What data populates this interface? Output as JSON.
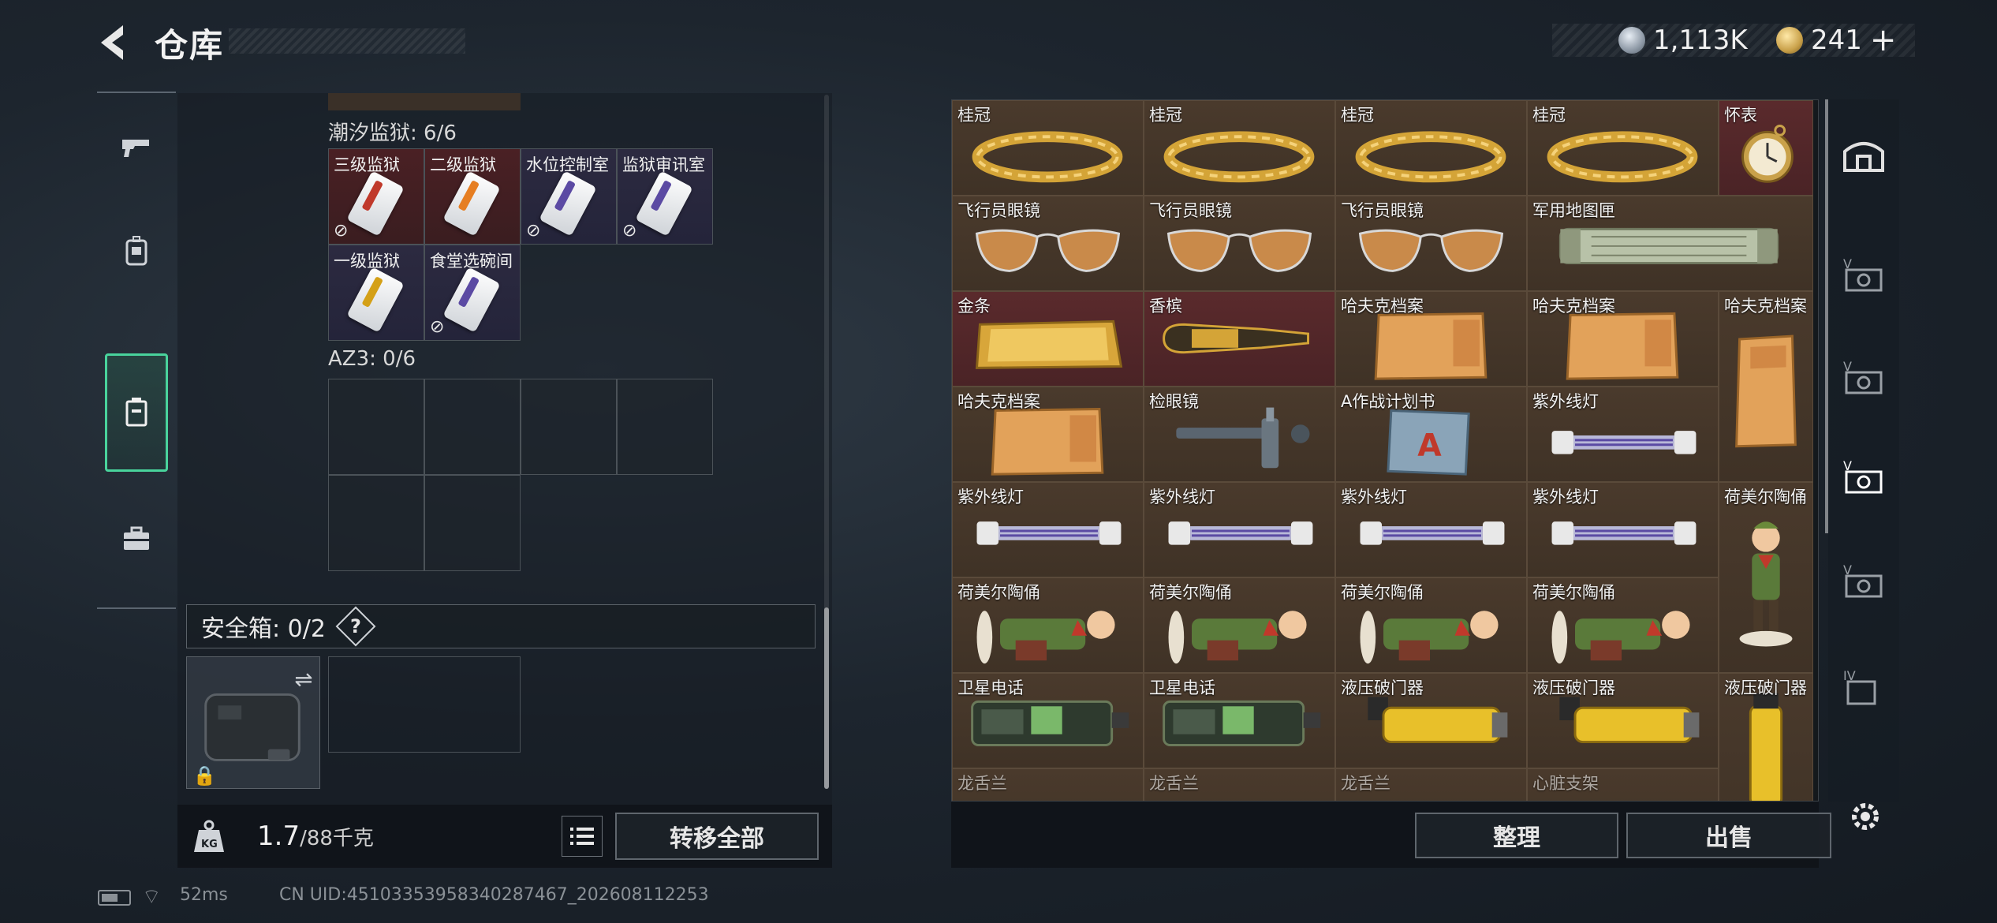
{
  "header": {
    "title": "仓库",
    "currency_coin": "1,113K",
    "currency_gold": "241",
    "currency_plus": "+"
  },
  "left_nav": {
    "items": [
      "weapons",
      "gear",
      "storage",
      "keys"
    ]
  },
  "key_section": {
    "group1_label": "潮汐监狱: 6/6",
    "keys": [
      {
        "name": "三级监狱",
        "has_badge": true
      },
      {
        "name": "二级监狱",
        "has_badge": false
      },
      {
        "name": "水位控制室",
        "has_badge": true
      },
      {
        "name": "监狱审讯室",
        "has_badge": true
      },
      {
        "name": "一级监狱",
        "has_badge": false
      },
      {
        "name": "食堂选碗间",
        "has_badge": true
      }
    ],
    "group2_label": "AZ3: 0/6"
  },
  "safe_box": {
    "label": "安全箱: 0/2",
    "help": "?"
  },
  "weight": {
    "current": "1.7",
    "max": "/88千克"
  },
  "buttons": {
    "transfer_all": "转移全部",
    "sort": "整理",
    "sell": "出售"
  },
  "storage": {
    "items": [
      {
        "name": "桂冠"
      },
      {
        "name": "桂冠"
      },
      {
        "name": "桂冠"
      },
      {
        "name": "桂冠"
      },
      {
        "name": "怀表"
      },
      {
        "name": "飞行员眼镜"
      },
      {
        "name": "飞行员眼镜"
      },
      {
        "name": "飞行员眼镜"
      },
      {
        "name": "军用地图匣"
      },
      {
        "name": "金条"
      },
      {
        "name": "香槟"
      },
      {
        "name": "哈夫克档案"
      },
      {
        "name": "哈夫克档案"
      },
      {
        "name": "哈夫克档案"
      },
      {
        "name": "哈夫克档案"
      },
      {
        "name": "检眼镜"
      },
      {
        "name": "A作战计划书"
      },
      {
        "name": "紫外线灯"
      },
      {
        "name": "紫外线灯"
      },
      {
        "name": "紫外线灯"
      },
      {
        "name": "紫外线灯"
      },
      {
        "name": "紫外线灯"
      },
      {
        "name": "荷美尔陶俑"
      },
      {
        "name": "荷美尔陶俑"
      },
      {
        "name": "荷美尔陶俑"
      },
      {
        "name": "荷美尔陶俑"
      },
      {
        "name": "荷美尔陶俑"
      },
      {
        "name": "卫星电话"
      },
      {
        "name": "卫星电话"
      },
      {
        "name": "液压破门器"
      },
      {
        "name": "液压破门器"
      },
      {
        "name": "液压破门器"
      },
      {
        "name": "龙舌兰"
      },
      {
        "name": "龙舌兰"
      },
      {
        "name": "龙舌兰"
      },
      {
        "name": "心脏支架"
      }
    ]
  },
  "footer": {
    "ping": "52ms",
    "uid": "CN UID:4510335395834028746​7_202608112253"
  },
  "colors": {
    "accent_green": "#49d39c",
    "item_bg": "#4a3a2c",
    "item_bg_red": "#5a2a2c"
  }
}
